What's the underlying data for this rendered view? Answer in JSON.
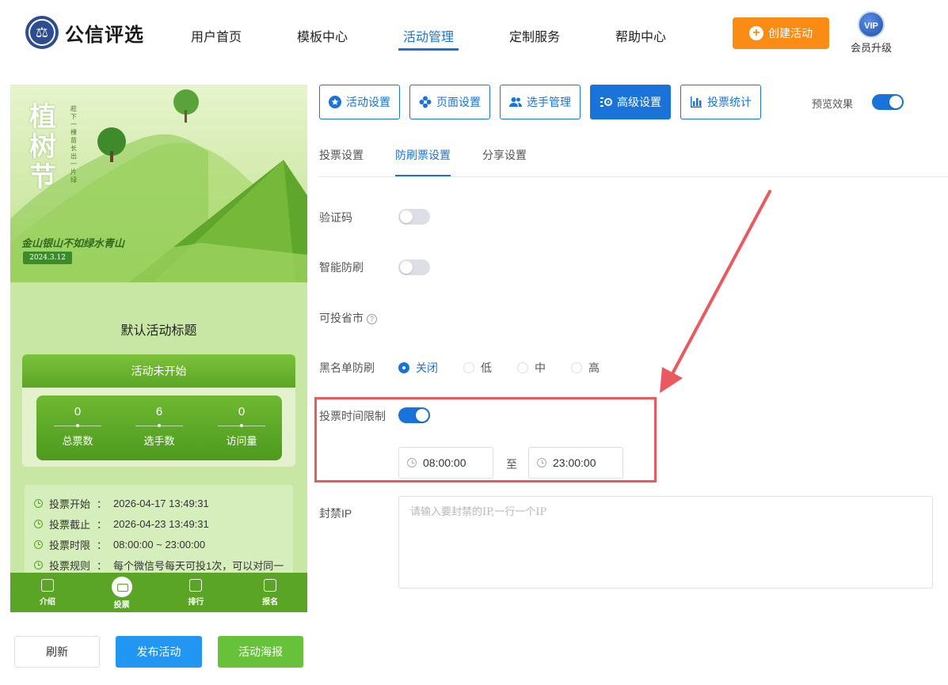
{
  "brand": {
    "name": "公信评选",
    "badge_char": "⚖"
  },
  "nav": {
    "items": [
      {
        "label": "用户首页"
      },
      {
        "label": "模板中心"
      },
      {
        "label": "活动管理"
      },
      {
        "label": "定制服务"
      },
      {
        "label": "帮助中心"
      }
    ],
    "active": "活动管理"
  },
  "create_button": {
    "label": "创建活动"
  },
  "vip": {
    "badge": "VIP",
    "label": "会员升级"
  },
  "preview": {
    "banner": {
      "title": "植树节",
      "vertical_text": "趁下一棵苗长出一片绿",
      "slogan": "金山银山不如绿水青山",
      "date": "2024.3.12"
    },
    "activity_title": "默认活动标题",
    "status": "活动未开始",
    "stats": [
      {
        "value": "0",
        "label": "总票数"
      },
      {
        "value": "6",
        "label": "选手数"
      },
      {
        "value": "0",
        "label": "访问量"
      }
    ],
    "info": [
      {
        "label": "投票开始",
        "value": "2026-04-17 13:49:31"
      },
      {
        "label": "投票截止",
        "value": "2026-04-23 13:49:31"
      },
      {
        "label": "投票时限",
        "value": "08:00:00 ~ 23:00:00"
      },
      {
        "label": "投票规则",
        "value": "每个微信号每天可投1次，可以对同一"
      }
    ],
    "tabbar": [
      {
        "label": "介绍"
      },
      {
        "label": "投票"
      },
      {
        "label": "排行"
      },
      {
        "label": "报名"
      }
    ]
  },
  "bottom_buttons": {
    "refresh": "刷新",
    "publish": "发布活动",
    "poster": "活动海报"
  },
  "toolbar": {
    "items": [
      {
        "label": "活动设置",
        "icon": "star-icon"
      },
      {
        "label": "页面设置",
        "icon": "flower-icon"
      },
      {
        "label": "选手管理",
        "icon": "users-icon"
      },
      {
        "label": "高级设置",
        "icon": "gears-icon"
      },
      {
        "label": "投票统计",
        "icon": "bar-chart-icon"
      }
    ],
    "active": "高级设置",
    "preview_label": "预览效果",
    "preview_on": true
  },
  "subtabs": {
    "items": [
      {
        "label": "投票设置"
      },
      {
        "label": "防刷票设置"
      },
      {
        "label": "分享设置"
      }
    ],
    "active": "防刷票设置"
  },
  "form": {
    "captcha": {
      "label": "验证码",
      "on": false
    },
    "smart_guard": {
      "label": "智能防刷",
      "on": false
    },
    "province_city": {
      "label": "可投省市"
    },
    "blacklist": {
      "label": "黑名单防刷",
      "options": [
        {
          "label": "关闭"
        },
        {
          "label": "低"
        },
        {
          "label": "中"
        },
        {
          "label": "高"
        }
      ],
      "selected": "关闭"
    },
    "time_limit": {
      "label": "投票时间限制",
      "on": true,
      "start": "08:00:00",
      "to": "至",
      "end": "23:00:00"
    },
    "ban_ip": {
      "label": "封禁IP",
      "placeholder": "请输入要封禁的IP,一行一个IP",
      "value": ""
    }
  },
  "colors": {
    "primary": "#1a73d9",
    "orange": "#fa8c16",
    "green": "#5ba526",
    "annotation": "#e85a5e"
  }
}
